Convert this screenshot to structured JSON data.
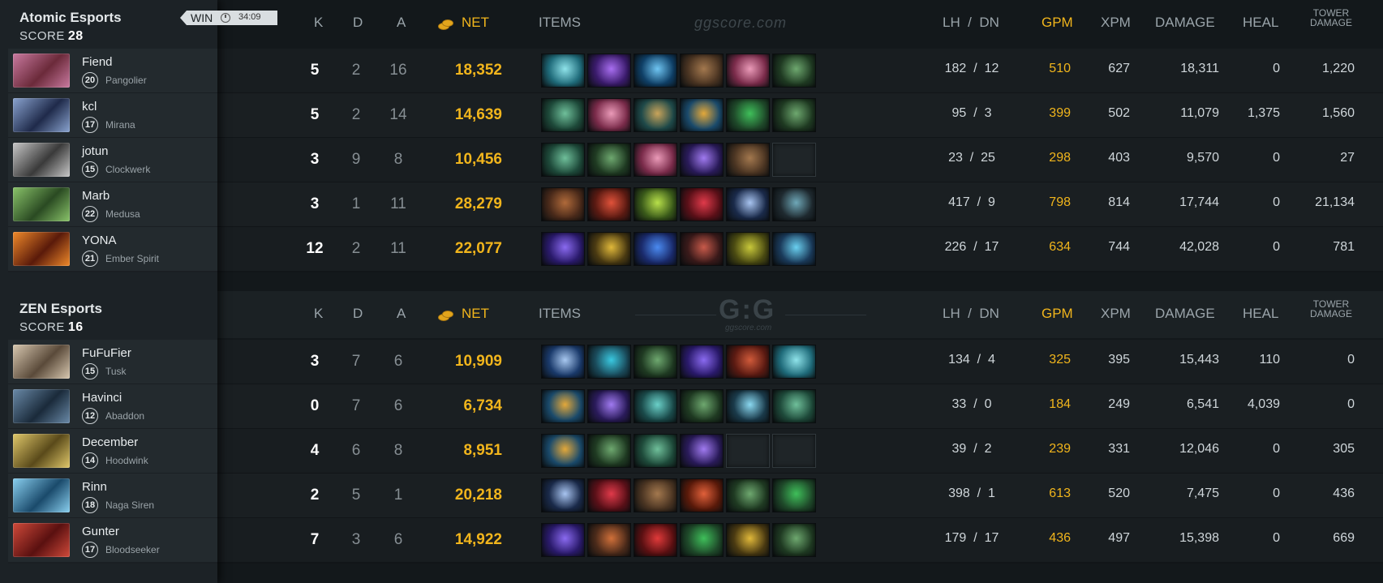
{
  "header": {
    "k": "K",
    "d": "D",
    "a": "A",
    "net": "NET",
    "items": "ITEMS",
    "lh_dn": "LH  /  DN",
    "gpm": "GPM",
    "xpm": "XPM",
    "damage": "DAMAGE",
    "heal": "HEAL",
    "tower_damage_1": "TOWER",
    "tower_damage_2": "DAMAGE",
    "watermark": "ggscore.com",
    "logo": "G:G",
    "logo_sub": "ggscore.com"
  },
  "match": {
    "result": "WIN",
    "duration": "34:09"
  },
  "colors": {
    "accent_gold": "#f1b51c",
    "background": "#13181b",
    "sidebar": "#1c2226"
  },
  "teams": [
    {
      "name": "Atomic Esports",
      "score_label": "SCORE",
      "score": "28",
      "players": [
        {
          "name": "Fiend",
          "level": "20",
          "hero": "Pangolier",
          "k": "5",
          "d": "2",
          "a": "16",
          "net": "18,352",
          "lh": "182",
          "dn": "12",
          "gpm": "510",
          "xpm": "627",
          "damage": "18,311",
          "heal": "0",
          "tower": "1,220",
          "avatar": [
            "#6b2a3a",
            "#c97aa0"
          ],
          "items": [
            [
              "#1f6b7a",
              "#8fe3ea"
            ],
            [
              "#3a1b6b",
              "#a86ef0"
            ],
            [
              "#0f3f66",
              "#6fc5f2"
            ],
            [
              "#4a3422",
              "#a3784e"
            ],
            [
              "#7a2b4a",
              "#ea9ab8"
            ],
            [
              "#1f3a22",
              "#6ea86f"
            ]
          ]
        },
        {
          "name": "kcl",
          "level": "17",
          "hero": "Mirana",
          "k": "5",
          "d": "2",
          "a": "14",
          "net": "14,639",
          "lh": "95",
          "dn": "3",
          "gpm": "399",
          "xpm": "502",
          "damage": "11,079",
          "heal": "1,375",
          "tower": "1,560",
          "avatar": [
            "#1f2a4a",
            "#8aa4d0"
          ],
          "items": [
            [
              "#1e4a3a",
              "#6fbf9a"
            ],
            [
              "#7a2b4a",
              "#ea9ab8"
            ],
            [
              "#1f4a4a",
              "#c9a45a"
            ],
            [
              "#1a4a6b",
              "#e3a83a"
            ],
            [
              "#1f4a2a",
              "#3fbf5a"
            ],
            [
              "#1f3a22",
              "#6ea86f"
            ]
          ]
        },
        {
          "name": "jotun",
          "level": "15",
          "hero": "Clockwerk",
          "k": "3",
          "d": "9",
          "a": "8",
          "net": "10,456",
          "lh": "23",
          "dn": "25",
          "gpm": "298",
          "xpm": "403",
          "damage": "9,570",
          "heal": "0",
          "tower": "27",
          "avatar": [
            "#3a3a3a",
            "#c8c8c8"
          ],
          "items": [
            [
              "#1e4a3a",
              "#6fbf9a"
            ],
            [
              "#1f3a22",
              "#6ea86f"
            ],
            [
              "#7a2b4a",
              "#ea9ab8"
            ],
            [
              "#2a1b5a",
              "#a07af0"
            ],
            [
              "#4a3422",
              "#a3784e"
            ],
            [
              "empty",
              "empty"
            ]
          ]
        },
        {
          "name": "Marb",
          "level": "22",
          "hero": "Medusa",
          "k": "3",
          "d": "1",
          "a": "11",
          "net": "28,279",
          "lh": "417",
          "dn": "9",
          "gpm": "798",
          "xpm": "814",
          "damage": "17,744",
          "heal": "0",
          "tower": "21,134",
          "avatar": [
            "#2a4a22",
            "#8ac46a"
          ],
          "items": [
            [
              "#4a2a1a",
              "#b06a3a"
            ],
            [
              "#5a1a12",
              "#e0523a"
            ],
            [
              "#3a5a1a",
              "#b8e04a"
            ],
            [
              "#5a1018",
              "#e03a4a"
            ],
            [
              "#1a2a4a",
              "#a8c4f0"
            ],
            [
              "#1f2a30",
              "#6fa8b8"
            ]
          ]
        },
        {
          "name": "YONA",
          "level": "21",
          "hero": "Ember Spirit",
          "k": "12",
          "d": "2",
          "a": "11",
          "net": "22,077",
          "lh": "226",
          "dn": "17",
          "gpm": "634",
          "xpm": "744",
          "damage": "42,028",
          "heal": "0",
          "tower": "781",
          "avatar": [
            "#5a1a0a",
            "#f08a2a"
          ],
          "items": [
            [
              "#2a1a6b",
              "#8a6af0"
            ],
            [
              "#4a3a12",
              "#e0b83a"
            ],
            [
              "#1a2a6b",
              "#4a8af0"
            ],
            [
              "#3a1a1a",
              "#c85a4a"
            ],
            [
              "#4a4a12",
              "#c8c83a"
            ],
            [
              "#1a3a5a",
              "#6ad0f0"
            ]
          ]
        }
      ]
    },
    {
      "name": "ZEN Esports",
      "score_label": "SCORE",
      "score": "16",
      "players": [
        {
          "name": "FuFuFier",
          "level": "15",
          "hero": "Tusk",
          "k": "3",
          "d": "7",
          "a": "6",
          "net": "10,909",
          "lh": "134",
          "dn": "4",
          "gpm": "325",
          "xpm": "395",
          "damage": "15,443",
          "heal": "110",
          "tower": "0",
          "avatar": [
            "#5a4a3a",
            "#d8c8b0"
          ],
          "items": [
            [
              "#1a3a6b",
              "#a8c8f0"
            ],
            [
              "#1a4a5a",
              "#3ac8e0"
            ],
            [
              "#1f3a22",
              "#6ea86f"
            ],
            [
              "#2a1a6b",
              "#8a6af0"
            ],
            [
              "#5a1a12",
              "#d05a3a"
            ],
            [
              "#1f6b7a",
              "#8fe3ea"
            ]
          ]
        },
        {
          "name": "Havinci",
          "level": "12",
          "hero": "Abaddon",
          "k": "0",
          "d": "7",
          "a": "6",
          "net": "6,734",
          "lh": "33",
          "dn": "0",
          "gpm": "184",
          "xpm": "249",
          "damage": "6,541",
          "heal": "4,039",
          "tower": "0",
          "avatar": [
            "#1a2a3a",
            "#6a8aa8"
          ],
          "items": [
            [
              "#1a4a6b",
              "#e3a83a"
            ],
            [
              "#2a1b5a",
              "#a07af0"
            ],
            [
              "#1a4a4a",
              "#6ad0c8"
            ],
            [
              "#1f3a22",
              "#6ea86f"
            ],
            [
              "#1a3a4a",
              "#8ad8f0"
            ],
            [
              "#1e4a3a",
              "#6fbf9a"
            ]
          ]
        },
        {
          "name": "December",
          "level": "14",
          "hero": "Hoodwink",
          "k": "4",
          "d": "6",
          "a": "8",
          "net": "8,951",
          "lh": "39",
          "dn": "2",
          "gpm": "239",
          "xpm": "331",
          "damage": "12,046",
          "heal": "0",
          "tower": "305",
          "avatar": [
            "#5a4a1a",
            "#e0c86a"
          ],
          "items": [
            [
              "#1a4a6b",
              "#e3a83a"
            ],
            [
              "#1f3a22",
              "#6ea86f"
            ],
            [
              "#1e4a3a",
              "#6fbf9a"
            ],
            [
              "#2a1b5a",
              "#a07af0"
            ],
            [
              "empty",
              "empty"
            ],
            [
              "empty",
              "empty"
            ]
          ]
        },
        {
          "name": "Rinn",
          "level": "18",
          "hero": "Naga Siren",
          "k": "2",
          "d": "5",
          "a": "1",
          "net": "20,218",
          "lh": "398",
          "dn": "1",
          "gpm": "613",
          "xpm": "520",
          "damage": "7,475",
          "heal": "0",
          "tower": "436",
          "avatar": [
            "#1a4a6b",
            "#8ad0f0"
          ],
          "items": [
            [
              "#1a2a4a",
              "#a8c4f0"
            ],
            [
              "#5a1018",
              "#e03a4a"
            ],
            [
              "#4a3422",
              "#a3784e"
            ],
            [
              "#5a1a0a",
              "#e0603a"
            ],
            [
              "#1f3a22",
              "#6ea86f"
            ],
            [
              "#1f4a2a",
              "#3fbf5a"
            ]
          ]
        },
        {
          "name": "Gunter",
          "level": "17",
          "hero": "Bloodseeker",
          "k": "7",
          "d": "3",
          "a": "6",
          "net": "14,922",
          "lh": "179",
          "dn": "17",
          "gpm": "436",
          "xpm": "497",
          "damage": "15,398",
          "heal": "0",
          "tower": "669",
          "avatar": [
            "#5a1010",
            "#d04a3a"
          ],
          "items": [
            [
              "#2a1a6b",
              "#8a6af0"
            ],
            [
              "#4a2a1a",
              "#d0703a"
            ],
            [
              "#5a1012",
              "#e03a3a"
            ],
            [
              "#1f4a2a",
              "#3fbf5a"
            ],
            [
              "#4a3a12",
              "#e0b83a"
            ],
            [
              "#1f3a22",
              "#6ea86f"
            ]
          ]
        }
      ]
    }
  ]
}
